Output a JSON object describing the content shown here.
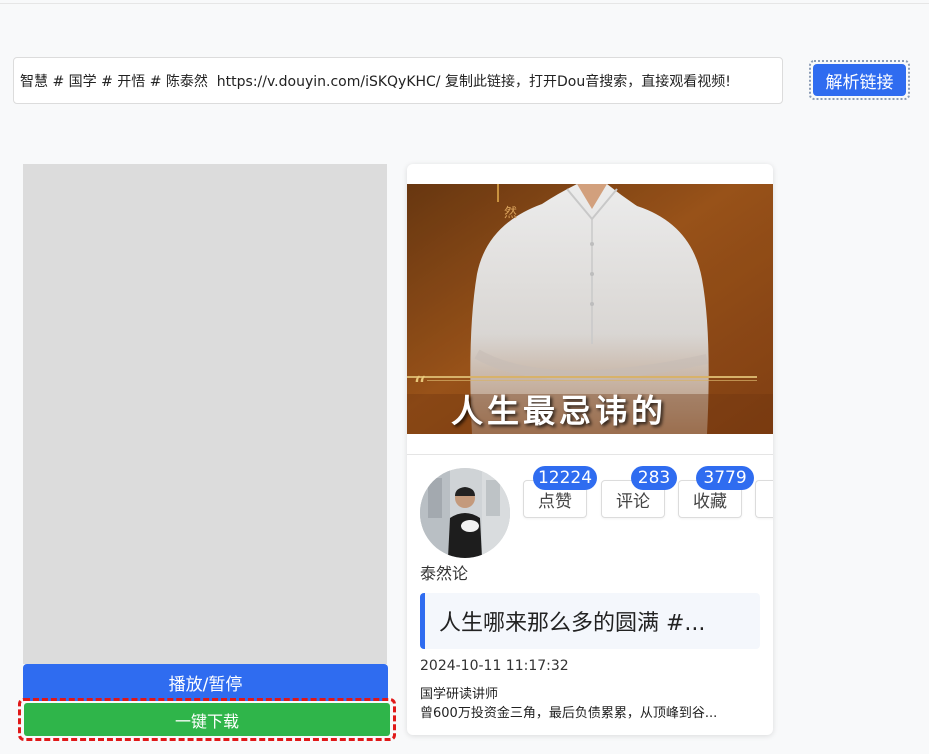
{
  "search": {
    "url_value": "智慧 # 国学 # 开悟 # 陈泰然  https://v.douyin.com/iSKQyKHC/ 复制此链接，打开Dou音搜索，直接观看视频!"
  },
  "toolbar": {
    "parse_label": "解析链接"
  },
  "player": {
    "play_pause_label": "播放/暂停",
    "download_label": "一键下载"
  },
  "card": {
    "cover_title": "人生最忌讳的",
    "cover_mark": "然",
    "cover_quote": "“",
    "author_name": "泰然论",
    "stats": [
      {
        "label": "点赞",
        "count": "12224"
      },
      {
        "label": "评论",
        "count": "283"
      },
      {
        "label": "收藏",
        "count": "3779"
      }
    ],
    "description": "人生哪来那么多的圆满 #...",
    "date": "2024-10-11 11:17:32",
    "bio_line1": "国学研读讲师",
    "bio_line2": "曾600万投资金三角，最后负债累累，从顶峰到谷..."
  },
  "colors": {
    "primary": "#2f6cf0",
    "download": "#2fb54a",
    "highlight": "#e01818"
  }
}
